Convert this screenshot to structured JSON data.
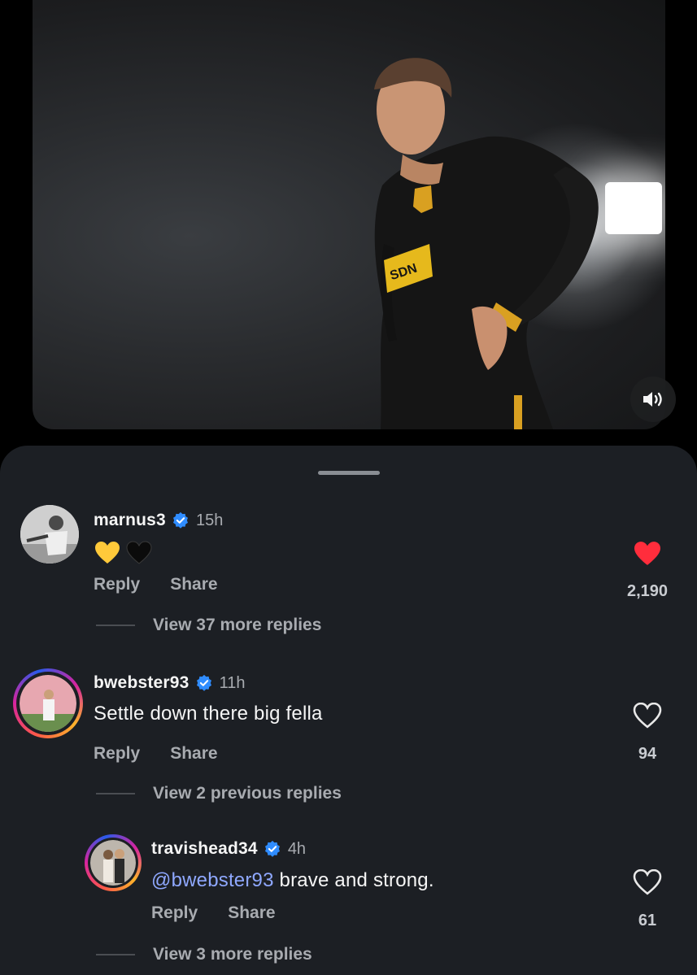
{
  "video": {
    "sound_icon": "speaker-wave-icon"
  },
  "comments": [
    {
      "username": "marnus3",
      "verified": true,
      "time": "15h",
      "emojis": [
        "yellow-heart",
        "black-heart"
      ],
      "reply_label": "Reply",
      "share_label": "Share",
      "liked": true,
      "like_count": "2,190",
      "view_more": "View 37 more replies"
    },
    {
      "username": "bwebster93",
      "verified": true,
      "time": "11h",
      "text": "Settle down there big fella",
      "reply_label": "Reply",
      "share_label": "Share",
      "liked": false,
      "like_count": "94",
      "view_more": "View 2 previous replies"
    },
    {
      "username": "travishead34",
      "verified": true,
      "time": "4h",
      "mention": "@bwebster93",
      "text": " brave and strong.",
      "reply_label": "Reply",
      "share_label": "Share",
      "liked": false,
      "like_count": "61",
      "view_more": "View 3 more replies"
    }
  ],
  "colors": {
    "sheet_bg": "#1c1f24",
    "verified_blue": "#2f8cff",
    "like_red": "#ff2d3c",
    "mention": "#8fa8ff"
  }
}
